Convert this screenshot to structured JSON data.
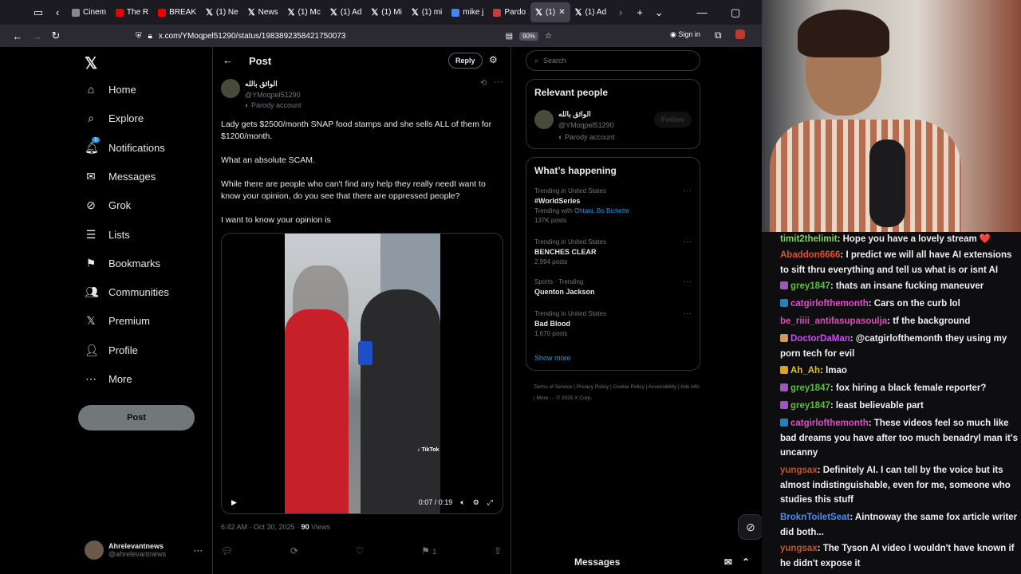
{
  "browser": {
    "tabs": [
      "Cinem",
      "The R",
      "BREAK",
      "(1) Ne",
      "News",
      "(1) Mc",
      "(1) Ad",
      "(1) Mi",
      "(1) mi",
      "mike j",
      "Pardo",
      "(1)",
      "(1) Ad"
    ],
    "url": "x.com/YMoqpel51290/status/1983892358421750073",
    "zoom": "90%",
    "signin": "Sign in"
  },
  "nav": {
    "items": [
      "Home",
      "Explore",
      "Notifications",
      "Messages",
      "Grok",
      "Lists",
      "Bookmarks",
      "Communities",
      "Premium",
      "Profile",
      "More"
    ],
    "notif_badge": "1",
    "post": "Post",
    "account_name": "Ahrelevantnews",
    "account_handle": "@ahrelevantnews"
  },
  "post": {
    "header": "Post",
    "reply": "Reply",
    "author": "الواثق بالله",
    "handle": "@YMoqpel51290",
    "parody": "Parody account",
    "p1": "Lady gets $2500/month SNAP food stamps and she sells ALL of them for $1200/month.",
    "p2": "What an absolute SCAM.",
    "p3": "While there are people who can't find any help they really needI want to know your opinion, do you see that there are oppressed people?",
    "p4": "I want to know your opinion is",
    "time": "0:07 / 0:19",
    "tiktok": "TikTok",
    "date": "6:42 AM · Oct 30, 2025 ·",
    "views_num": "90",
    "views_label": "Views",
    "bookmarks": "1"
  },
  "right": {
    "search": "Search",
    "relevant": "Relevant people",
    "rp_name": "الواثق بالله",
    "rp_handle": "@YMoqpel51290",
    "rp_parody": "Parody account",
    "follow": "Follow",
    "happening": "What’s happening",
    "trends": [
      {
        "ctx": "Trending in United States",
        "name": "#WorldSeries",
        "extra1": "Trending with",
        "extra2": "Ohtani, Bo Bichette",
        "posts": "137K posts"
      },
      {
        "ctx": "Trending in United States",
        "name": "BENCHES CLEAR",
        "posts": "2,994 posts"
      },
      {
        "ctx": "Sports · Trending",
        "name": "Quenton Jackson",
        "posts": ""
      },
      {
        "ctx": "Trending in United States",
        "name": "Bad Blood",
        "posts": "1,670 posts"
      }
    ],
    "show_more": "Show more",
    "footer": "Terms of Service | Privacy Policy | Cookie Policy | Accessibility | Ads info | More ··· © 2025 X Corp."
  },
  "messages_bar": "Messages",
  "chat": [
    {
      "user": "timit2thelimit",
      "color": "#7fd65a",
      "text": ": Hope you have a lovely stream ❤️"
    },
    {
      "user": "Abaddon6666",
      "color": "#e0502a",
      "text": ": I predict we will all have AI extensions to sift thru everything and tell us what is or isnt AI"
    },
    {
      "user": "grey1847",
      "color": "#5fbf3a",
      "text": ": thats an insane fucking maneuver"
    },
    {
      "user": "catgirlofthemonth",
      "color": "#e04cc8",
      "text": ": Cars on the curb lol"
    },
    {
      "user": "be_riiii_antifasupasoulja",
      "color": "#d84cb8",
      "text": ": tf the background"
    },
    {
      "user": "DoctorDaMan",
      "color": "#c94cf0",
      "text": ": @catgirlofthemonth they using my porn tech for evil"
    },
    {
      "user": "Ah_Ah",
      "color": "#d7c22a",
      "text": ": lmao"
    },
    {
      "user": "grey1847",
      "color": "#5fbf3a",
      "text": ": fox hiring a black female reporter?"
    },
    {
      "user": "grey1847",
      "color": "#5fbf3a",
      "text": ": least believable part"
    },
    {
      "user": "catgirlofthemonth",
      "color": "#e04cc8",
      "text": ": These videos feel so much like bad dreams you have after too much benadryl man it's uncanny"
    },
    {
      "user": "yungsax",
      "color": "#c0542a",
      "text": ": Definitely AI. I can tell by the voice but its almost indistinguishable, even for me, someone who studies this stuff"
    },
    {
      "user": "BroknToiletSeat",
      "color": "#4c8cf0",
      "text": ": Aintnoway the same fox article writer did both..."
    },
    {
      "user": "yungsax",
      "color": "#c0542a",
      "text": ": The Tyson AI video I wouldn't have known if he didn't expose it"
    }
  ]
}
